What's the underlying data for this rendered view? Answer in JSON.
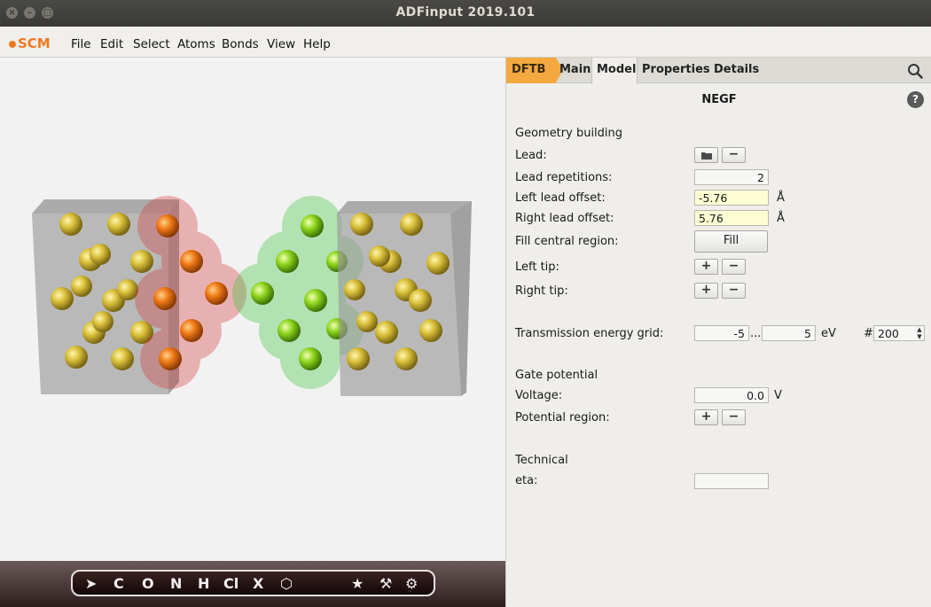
{
  "window": {
    "title": "ADFinput 2019.101"
  },
  "menubar": {
    "logo": "SCM",
    "items": [
      "File",
      "Edit",
      "Select",
      "Atoms",
      "Bonds",
      "View",
      "Help"
    ]
  },
  "toolbar": {
    "tools": [
      "C",
      "O",
      "N",
      "H",
      "Cl",
      "X",
      "⬡",
      "★",
      "⚒",
      "⚙"
    ]
  },
  "panel": {
    "tabs": {
      "engine": "DFTB",
      "main": "Main",
      "model": "Model",
      "properties": "Properties",
      "details": "Details"
    },
    "section": "NEGF",
    "help": "?",
    "geometry": {
      "heading": "Geometry building",
      "lead_label": "Lead:",
      "lead_repetitions_label": "Lead repetitions:",
      "lead_repetitions": "2",
      "left_offset_label": "Left lead offset:",
      "left_offset": "-5.76",
      "right_offset_label": "Right lead offset:",
      "right_offset": "5.76",
      "offset_unit": "Å",
      "fill_label": "Fill central region:",
      "fill_button": "Fill",
      "left_tip_label": "Left tip:",
      "right_tip_label": "Right tip:"
    },
    "transmission": {
      "label": "Transmission energy grid:",
      "min": "-5",
      "dots": "...",
      "max": "5",
      "unit": "eV",
      "count_prefix": "#",
      "count": "200"
    },
    "gate": {
      "heading": "Gate potential",
      "voltage_label": "Voltage:",
      "voltage": "0.0",
      "voltage_unit": "V",
      "region_label": "Potential region:"
    },
    "technical": {
      "heading": "Technical",
      "eta_label": "eta:",
      "eta": ""
    }
  },
  "colors": {
    "accent": "#f3a940",
    "logo": "#f07820",
    "lead_atom": "#d9c03a",
    "left_tip": "#e8541c",
    "right_tip": "#7ed320"
  }
}
